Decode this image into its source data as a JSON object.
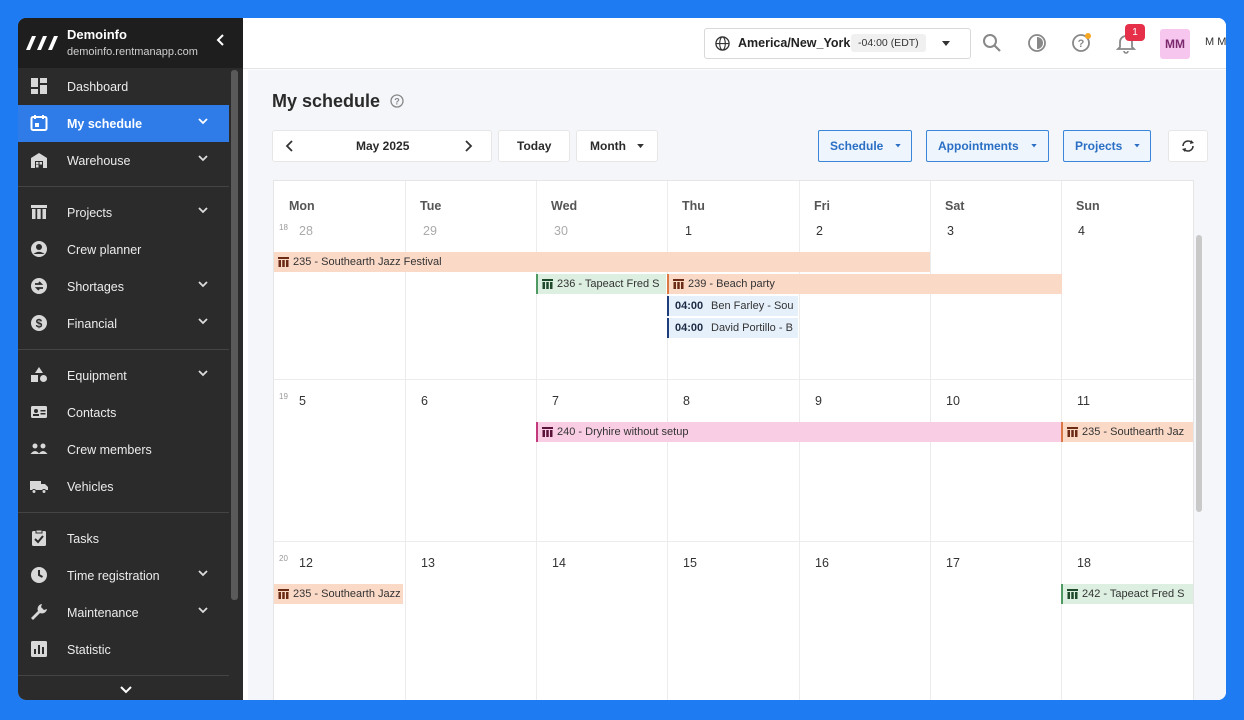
{
  "brand": {
    "name": "Demoinfo",
    "url": "demoinfo.rentmanapp.com"
  },
  "sidebar": {
    "items": [
      {
        "label": "Dashboard",
        "icon": "dashboard-icon",
        "chevron": false
      },
      {
        "label": "My schedule",
        "icon": "calendar-icon",
        "chevron": true,
        "active": true
      },
      {
        "label": "Warehouse",
        "icon": "warehouse-icon",
        "chevron": true
      },
      {
        "label": "Projects",
        "icon": "projects-icon",
        "chevron": true
      },
      {
        "label": "Crew planner",
        "icon": "person-icon",
        "chevron": false
      },
      {
        "label": "Shortages",
        "icon": "shortages-icon",
        "chevron": true
      },
      {
        "label": "Financial",
        "icon": "dollar-icon",
        "chevron": true
      },
      {
        "label": "Equipment",
        "icon": "equipment-icon",
        "chevron": true
      },
      {
        "label": "Contacts",
        "icon": "contacts-icon",
        "chevron": false
      },
      {
        "label": "Crew members",
        "icon": "crew-icon",
        "chevron": false
      },
      {
        "label": "Vehicles",
        "icon": "truck-icon",
        "chevron": false
      },
      {
        "label": "Tasks",
        "icon": "tasks-icon",
        "chevron": false
      },
      {
        "label": "Time registration",
        "icon": "clock-icon",
        "chevron": true
      },
      {
        "label": "Maintenance",
        "icon": "wrench-icon",
        "chevron": true
      },
      {
        "label": "Statistic",
        "icon": "chart-icon",
        "chevron": false
      }
    ]
  },
  "topbar": {
    "timezone": "America/New_York",
    "offset": "-04:00 (EDT)",
    "notification_count": "1",
    "avatar": "MM",
    "user_initials": "M M"
  },
  "page": {
    "title": "My schedule"
  },
  "toolbar": {
    "period": "May 2025",
    "today": "Today",
    "view": "Month",
    "filters": [
      "Schedule",
      "Appointments",
      "Projects"
    ]
  },
  "calendar": {
    "days": [
      "Mon",
      "Tue",
      "Wed",
      "Thu",
      "Fri",
      "Sat",
      "Sun"
    ],
    "weeks": [
      {
        "week": "18",
        "dates": [
          "28",
          "29",
          "30",
          "1",
          "2",
          "3",
          "4"
        ]
      },
      {
        "week": "19",
        "dates": [
          "5",
          "6",
          "7",
          "8",
          "9",
          "10",
          "11"
        ]
      },
      {
        "week": "20",
        "dates": [
          "12",
          "13",
          "14",
          "15",
          "16",
          "17",
          "18"
        ]
      }
    ],
    "events": [
      {
        "title": "235 - Southearth Jazz Festival"
      },
      {
        "title": "236 - Tapeact Fred S"
      },
      {
        "title": "239 - Beach party"
      },
      {
        "time": "04:00",
        "who": "Ben Farley - Sou"
      },
      {
        "time": "04:00",
        "who": "David Portillo - B"
      },
      {
        "title": "240 - Dryhire without setup"
      },
      {
        "title": "235 - Southearth Jaz"
      },
      {
        "title": "235 - Southearth Jazz"
      },
      {
        "title": "242 - Tapeact Fred S"
      }
    ]
  },
  "colors": {
    "accent": "#2f7ce8",
    "sidebar": "#2b2b2b",
    "background": "#1f7bf2"
  }
}
